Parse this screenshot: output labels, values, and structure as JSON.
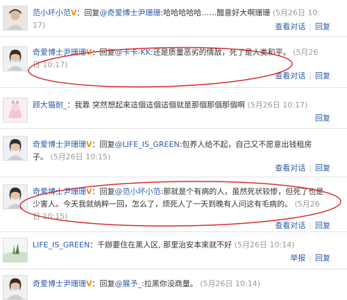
{
  "vmark": "V",
  "colon": "：",
  "comments": [
    {
      "username": "范小坏小范",
      "verified": true,
      "reply_prefix": "回复",
      "mention": "@奇爱博士尹珊珊",
      "body": ":哈哈哈哈哈……醋意好大啊珊珊",
      "time": "(5月26日 10:17)",
      "actions": [
        "查看对话",
        "回复"
      ]
    },
    {
      "username": "奇爱博士尹珊珊",
      "verified": true,
      "reply_prefix": "回复",
      "mention": "@卡卡-KK",
      "body": ":还是质量恶劣的情敌，死了是人类和平。",
      "time": "(5月26日 10:17)",
      "actions": [
        "查看对话",
        "回复"
      ]
    },
    {
      "username": "顾大猫耐_",
      "verified": false,
      "body": "我靠 突然想起來這個這個這個就是那個那個那個啊",
      "time": "(5月26日 10:17)",
      "actions": [
        "回复"
      ]
    },
    {
      "username": "奇爱博士尹珊珊",
      "verified": true,
      "reply_prefix": "回复",
      "mention": "@LIFE_IS_GREEN",
      "body": ":包养人给不起，自己又不愿意出钱租房子。",
      "time": "(5月26日 10:15)",
      "actions": [
        "查看对话",
        "回复"
      ]
    },
    {
      "username": "奇爱博士尹珊珊",
      "verified": true,
      "reply_prefix": "回复",
      "mention": "@范小坏小范",
      "body": ":那就是个有病的人，虽然死状较惨，但死了也是少害人。今天我就纳粹一回，怎么了，烦死人了一天到晚有人问这有毛病的。",
      "time": "(5月26日 10:15)",
      "actions": [
        "查看对话",
        "回复"
      ]
    },
    {
      "username": "LIFE_IS_GREEN",
      "verified": false,
      "body": "千辦要住在黑人区, 那里治安本來就不好",
      "time": "(5月26日 10:14)",
      "actions": [
        "举报",
        "回复"
      ]
    },
    {
      "username": "奇爱博士尹珊珊",
      "verified": true,
      "reply_prefix": "回复",
      "mention": "@展予_",
      "body": ":拉黑你没商量。",
      "time": "(5月26日 10:14)",
      "actions": []
    }
  ],
  "colors": {
    "link": "#2b5aa8",
    "time": "#999999",
    "separator": "#e2e2e2",
    "highlight_ellipse": "#d6292e",
    "verified_mark": "#f08c00"
  }
}
